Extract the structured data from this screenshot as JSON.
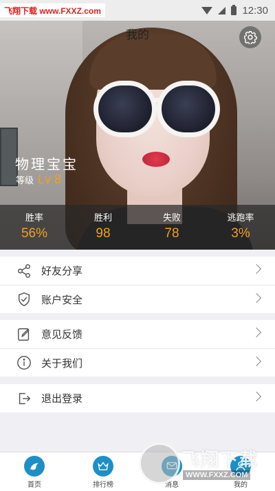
{
  "status_bar": {
    "watermark": "飞翔下载 www.FXXZ.com",
    "time": "12:30"
  },
  "header": {
    "title": "我的",
    "settings_icon": "gear-icon"
  },
  "profile": {
    "nickname": "物理宝宝",
    "level_label": "等级",
    "level_value": "Lv 8"
  },
  "stats": [
    {
      "label": "胜率",
      "value": "56%"
    },
    {
      "label": "胜利",
      "value": "98"
    },
    {
      "label": "失败",
      "value": "78"
    },
    {
      "label": "逃跑率",
      "value": "3%"
    }
  ],
  "menu": {
    "share": {
      "label": "好友分享",
      "icon": "share-icon"
    },
    "security": {
      "label": "账户安全",
      "icon": "shield-icon"
    },
    "feedback": {
      "label": "意见反馈",
      "icon": "edit-icon"
    },
    "about": {
      "label": "关于我们",
      "icon": "info-icon"
    },
    "logout": {
      "label": "退出登录",
      "icon": "logout-icon"
    }
  },
  "bottom_nav": [
    {
      "label": "首页",
      "icon": "home-icon"
    },
    {
      "label": "排行榜",
      "icon": "crown-icon"
    },
    {
      "label": "消息",
      "icon": "message-icon"
    },
    {
      "label": "我的",
      "icon": "profile-icon"
    }
  ],
  "overlay_watermark": {
    "text": "飞翔下载",
    "url": "WWW.FXXZ.COM"
  },
  "colors": {
    "accent": "#f0a020",
    "nav_icon": "#1d8fc6",
    "background": "#efeff4"
  }
}
